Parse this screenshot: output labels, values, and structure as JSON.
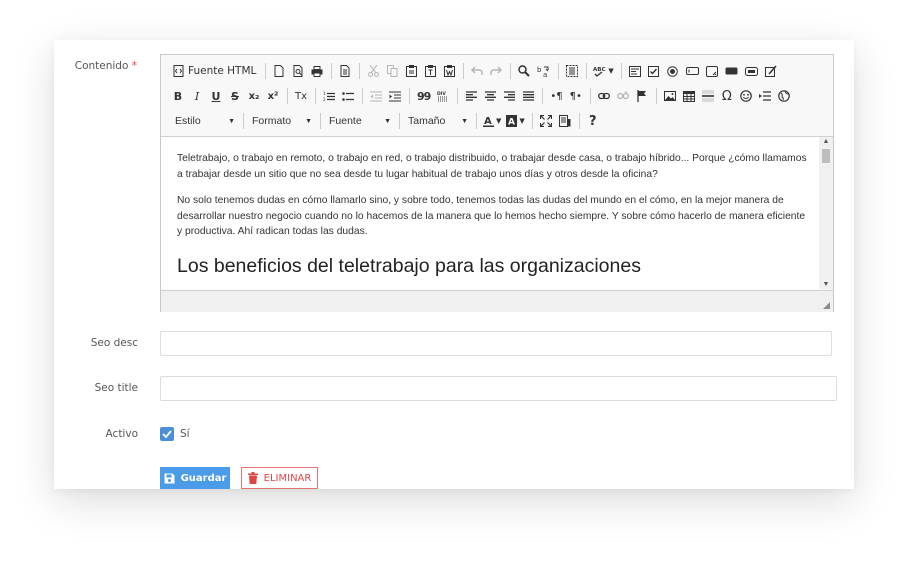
{
  "labels": {
    "contenido": "Contenido",
    "required_mark": "*",
    "seo_desc": "Seo desc",
    "seo_title": "Seo title",
    "activo": "Activo"
  },
  "toolbar": {
    "source_html": "Fuente HTML",
    "combos": {
      "estilo": "Estilo",
      "formato": "Formato",
      "fuente": "Fuente",
      "tamano": "Tamaño"
    },
    "help": "?",
    "bold": "B",
    "italic": "I",
    "underline": "U",
    "strike": "S",
    "subscript": "x₂",
    "superscript": "x²",
    "remove_format": "Tx",
    "blockquote": "99",
    "omega": "Ω"
  },
  "editor": {
    "paragraph1": "Teletrabajo, o trabajo en remoto, o trabajo en red, o trabajo distribuido, o trabajar desde casa, o trabajo híbrido...  Porque ¿cómo llamamos a trabajar desde un sitio que no sea desde tu lugar habitual de trabajo unos días y otros desde la oficina?",
    "paragraph2": "No solo tenemos dudas en cómo llamarlo sino, y sobre todo, tenemos todas las dudas del mundo en el cómo, en la mejor manera de desarrollar nuestro negocio cuando no lo hacemos de la manera que lo hemos hecho siempre. Y sobre cómo hacerlo de manera eficiente y productiva. Ahí radican todas las dudas.",
    "heading": "Los beneficios del teletrabajo para las organizaciones"
  },
  "fields": {
    "seo_desc_value": "",
    "seo_title_value": ""
  },
  "activo": {
    "checked": true,
    "label": "Sí"
  },
  "buttons": {
    "save": "Guardar",
    "delete": "ELIMINAR"
  },
  "colors": {
    "primary": "#4a9be8",
    "danger": "#e04545",
    "checkbox": "#4c8fd6"
  }
}
